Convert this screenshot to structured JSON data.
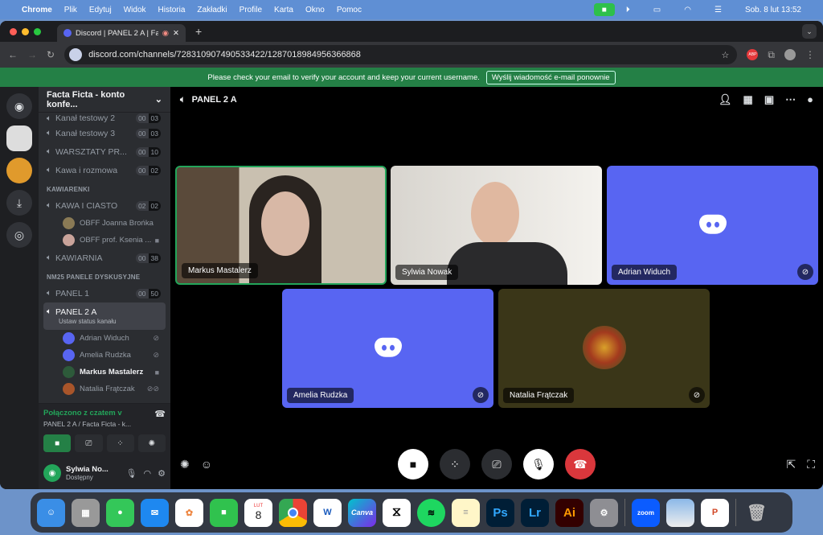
{
  "menubar": {
    "app": "Chrome",
    "items": [
      "Plik",
      "Edytuj",
      "Widok",
      "Historia",
      "Zakładki",
      "Profile",
      "Karta",
      "Okno",
      "Pomoc"
    ],
    "datetime": "Sob. 8 lut  13:52"
  },
  "browser": {
    "tab_title": "Discord | PANEL 2 A | Fac",
    "url": "discord.com/channels/728310907490533422/1287018984956366868",
    "extension": "ABP"
  },
  "banner": {
    "message": "Please check your email to verify your account and keep your current username.",
    "button": "Wyślij wiadomość e-mail ponownie"
  },
  "server": {
    "name": "Facta Ficta - konto konfe...",
    "channels": [
      {
        "name": "Kanał testowy 2",
        "a": "00",
        "b": "03"
      },
      {
        "name": "Kanał testowy 3",
        "a": "00",
        "b": "03"
      },
      {
        "name": "WARSZTATY PR...",
        "a": "00",
        "b": "10"
      },
      {
        "name": "Kawa i rozmowa",
        "a": "00",
        "b": "02"
      }
    ],
    "cat1": "KAWIARENKI",
    "kawa": {
      "name": "KAWA I CIASTO",
      "a": "02",
      "b": "02",
      "users": [
        "OBFF Joanna Brońka",
        "OBFF prof. Ksenia ..."
      ]
    },
    "kawiarnia": {
      "name": "KAWIARNIA",
      "a": "00",
      "b": "38"
    },
    "cat2": "NM25 PANELE DYSKUSYJNE",
    "panel1": {
      "name": "PANEL 1",
      "a": "00",
      "b": "50"
    },
    "panel2": {
      "name": "PANEL 2 A",
      "status": "Ustaw status kanału",
      "users": [
        "Adrian Widuch",
        "Amelia Rudzka",
        "Markus Mastalerz",
        "Natalia Frątczak"
      ]
    }
  },
  "voice": {
    "connected": "Połączono z czatem v",
    "location": "PANEL 2 A / Facta Ficta - k..."
  },
  "me": {
    "name": "Sylwia No...",
    "status": "Dostępny"
  },
  "main": {
    "channel": "PANEL 2 A",
    "tiles": [
      {
        "name": "Markus Mastalerz",
        "type": "video"
      },
      {
        "name": "Sylwia Nowak",
        "type": "video"
      },
      {
        "name": "Adrian Widuch",
        "type": "avatar",
        "muted": true
      },
      {
        "name": "Amelia Rudzka",
        "type": "avatar",
        "muted": true
      },
      {
        "name": "Natalia Frątczak",
        "type": "avatar",
        "muted": true
      }
    ]
  },
  "dock": [
    "Finder",
    "Launchpad",
    "Messages",
    "Mail",
    "Photos",
    "FaceTime",
    "Calendar",
    "Chrome",
    "Word",
    "Canva",
    "CapCut",
    "Spotify",
    "Notes",
    "Ps",
    "Lr",
    "Ai",
    "System Settings",
    "zoom",
    "Preview",
    "PowerPoint",
    "Trash"
  ],
  "calendar": {
    "month": "LUT",
    "day": "8"
  },
  "colors": {
    "accent": "#5865f2",
    "green": "#248046",
    "danger": "#da373c"
  }
}
